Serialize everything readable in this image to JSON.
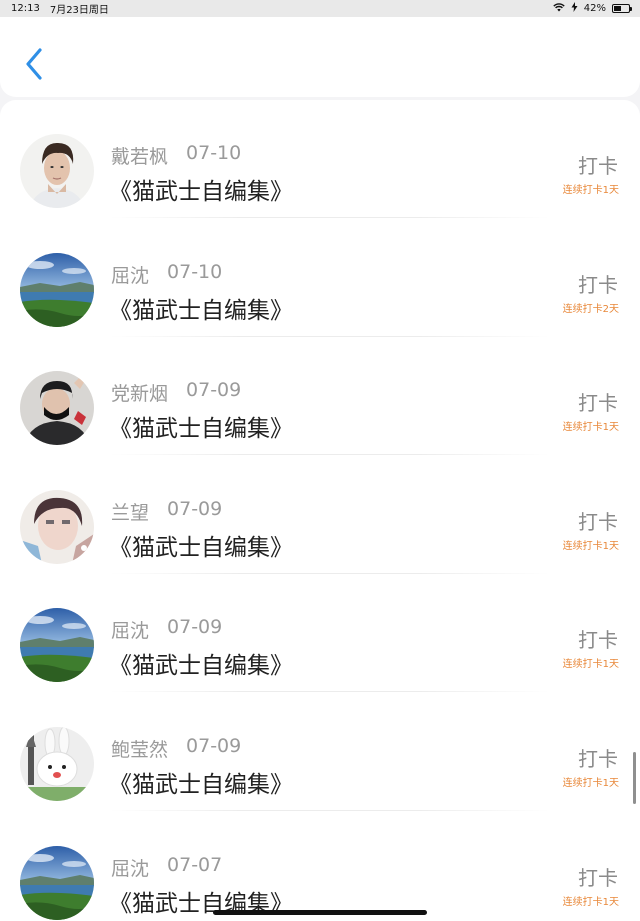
{
  "status_bar": {
    "time": "12:13",
    "date": "7月23日周日",
    "battery_text": "42%",
    "battery_level": 0.42
  },
  "header": {
    "back_icon": "chevron-left-icon",
    "accent_color": "#2f8fe6"
  },
  "records": [
    {
      "name": "戴若枫",
      "date": "07-10",
      "book": "《猫武士自编集》",
      "action": "打卡",
      "streak": "连续打卡1天",
      "avatar": "portrait-young-man"
    },
    {
      "name": "屈沈",
      "date": "07-10",
      "book": "《猫武士自编集》",
      "action": "打卡",
      "streak": "连续打卡2天",
      "avatar": "landscape-coast"
    },
    {
      "name": "党新烟",
      "date": "07-09",
      "book": "《猫武士自编集》",
      "action": "打卡",
      "streak": "连续打卡1天",
      "avatar": "portrait-masked"
    },
    {
      "name": "兰望",
      "date": "07-09",
      "book": "《猫武士自编集》",
      "action": "打卡",
      "streak": "连续打卡1天",
      "avatar": "portrait-soft"
    },
    {
      "name": "屈沈",
      "date": "07-09",
      "book": "《猫武士自编集》",
      "action": "打卡",
      "streak": "连续打卡1天",
      "avatar": "landscape-coast"
    },
    {
      "name": "鲍莹然",
      "date": "07-09",
      "book": "《猫武士自编集》",
      "action": "打卡",
      "streak": "连续打卡1天",
      "avatar": "plush-rabbit"
    },
    {
      "name": "屈沈",
      "date": "07-07",
      "book": "《猫武士自编集》",
      "action": "打卡",
      "streak": "连续打卡1天",
      "avatar": "landscape-coast"
    }
  ],
  "colors": {
    "streak": "#e8883a",
    "name_date": "#9a9a9a",
    "book_title": "#222222",
    "checkin": "#8a8a8a"
  }
}
